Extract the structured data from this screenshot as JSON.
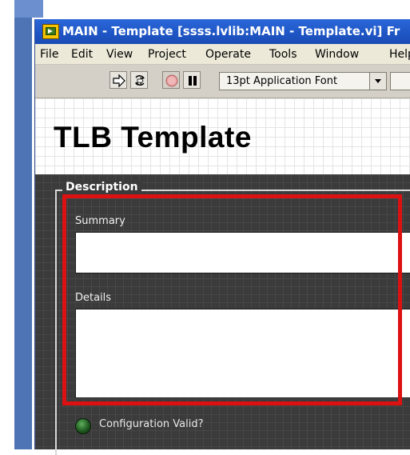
{
  "window": {
    "title": "MAIN - Template [ssss.lvlib:MAIN - Template.vi] Fr"
  },
  "menu": {
    "items": [
      {
        "label": "File"
      },
      {
        "label": "Edit"
      },
      {
        "label": "View"
      },
      {
        "label": "Project"
      },
      {
        "label": "Operate"
      },
      {
        "label": "Tools"
      },
      {
        "label": "Window"
      },
      {
        "label": "Help"
      }
    ]
  },
  "toolbar": {
    "font_selector": "13pt Application Font",
    "buttons": [
      {
        "icon": "run-arrow-icon"
      },
      {
        "icon": "run-continuously-icon"
      },
      {
        "icon": "abort-execution-icon"
      },
      {
        "icon": "pause-icon"
      }
    ]
  },
  "panel": {
    "title": "TLB Template",
    "description_label": "Description",
    "summary_label": "Summary",
    "summary_value": "",
    "details_label": "Details",
    "details_value": "",
    "config_valid_label": "Configuration Valid?"
  },
  "colors": {
    "titlebar": "#1f56c6",
    "highlight": "#dd1111",
    "panel_dark": "#3b3b3b",
    "led_green": "#1f5a1f"
  }
}
